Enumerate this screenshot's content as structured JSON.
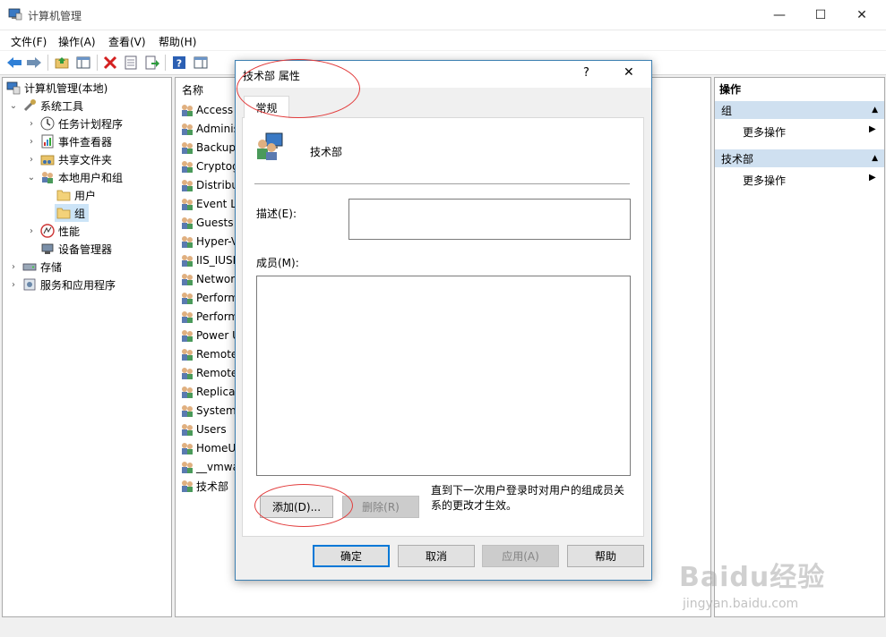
{
  "window": {
    "title": "计算机管理",
    "minimize_glyph": "—",
    "maximize_glyph": "☐",
    "close_glyph": "✕"
  },
  "menu": [
    "文件(F)",
    "操作(A)",
    "查看(V)",
    "帮助(H)"
  ],
  "toolbar_icons": [
    "back-icon",
    "forward-icon",
    "up-folder-icon",
    "show-hide-tree-icon",
    "delete-icon",
    "properties-icon",
    "export-icon",
    "help-icon",
    "view-icon"
  ],
  "tree": {
    "root": "计算机管理(本地)",
    "system_tools": "系统工具",
    "task_scheduler": "任务计划程序",
    "event_viewer": "事件查看器",
    "shared_folders": "共享文件夹",
    "local_users_groups": "本地用户和组",
    "users": "用户",
    "groups": "组",
    "performance": "性能",
    "device_manager": "设备管理器",
    "storage": "存储",
    "services_apps": "服务和应用程序"
  },
  "list": {
    "header": "名称",
    "items": [
      "Access",
      "Adminis",
      "Backup",
      "Cryptog",
      "Distribu",
      "Event Lo",
      "Guests",
      "Hyper-V",
      "IIS_IUSR",
      "Networ",
      "Perform",
      "Perform",
      "Power U",
      "Remote",
      "Remote",
      "Replicat",
      "System",
      "Users",
      "HomeU",
      "__vmwa",
      "技术部"
    ]
  },
  "actions": {
    "title": "操作",
    "section1": "组",
    "section1_more": "更多操作",
    "section2": "技术部",
    "section2_more": "更多操作"
  },
  "dialog": {
    "title": "技术部 属性",
    "help_glyph": "?",
    "close_glyph": "✕",
    "tab_general": "常规",
    "group_name": "技术部",
    "description_label": "描述(E):",
    "description_value": "",
    "members_label": "成员(M):",
    "add_button": "添加(D)...",
    "remove_button": "删除(R)",
    "note": "直到下一次用户登录时对用户的组成员关系的更改才生效。",
    "ok": "确定",
    "cancel": "取消",
    "apply": "应用(A)",
    "help": "帮助"
  },
  "watermark": {
    "logo": "Baidu经验",
    "url": "jingyan.baidu.com"
  },
  "colors": {
    "highlight_ellipse": "#e23b3b",
    "dialog_border": "#3c7fb1",
    "default_button_border": "#0078d7",
    "actions_header": "#cfe0f0"
  }
}
